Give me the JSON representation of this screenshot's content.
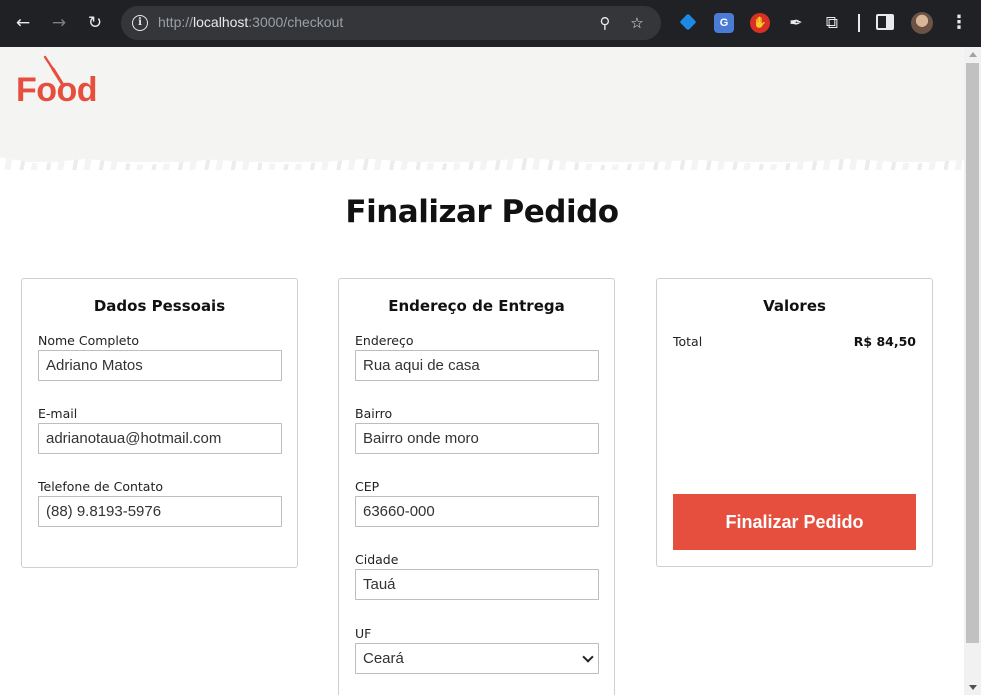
{
  "browser": {
    "url_prefix": "http://",
    "url_host": "localhost",
    "url_path": ":3000/checkout"
  },
  "brand": {
    "logo_text": "Food",
    "accent_color": "#e64f3e"
  },
  "page": {
    "title": "Finalizar Pedido"
  },
  "personal": {
    "title": "Dados Pessoais",
    "fields": [
      {
        "label": "Nome Completo",
        "value": "Adriano Matos"
      },
      {
        "label": "E-mail",
        "value": "adrianotaua@hotmail.com"
      },
      {
        "label": "Telefone de Contato",
        "value": "(88) 9.8193-5976"
      }
    ]
  },
  "address": {
    "title": "Endereço de Entrega",
    "fields": [
      {
        "label": "Endereço",
        "value": "Rua aqui de casa"
      },
      {
        "label": "Bairro",
        "value": "Bairro onde moro"
      },
      {
        "label": "CEP",
        "value": "63660-000"
      },
      {
        "label": "Cidade",
        "value": "Tauá"
      }
    ],
    "state_label": "UF",
    "state_value": "Ceará"
  },
  "values": {
    "title": "Valores",
    "total_label": "Total",
    "total_value": "R$ 84,50",
    "submit_label": "Finalizar Pedido"
  }
}
